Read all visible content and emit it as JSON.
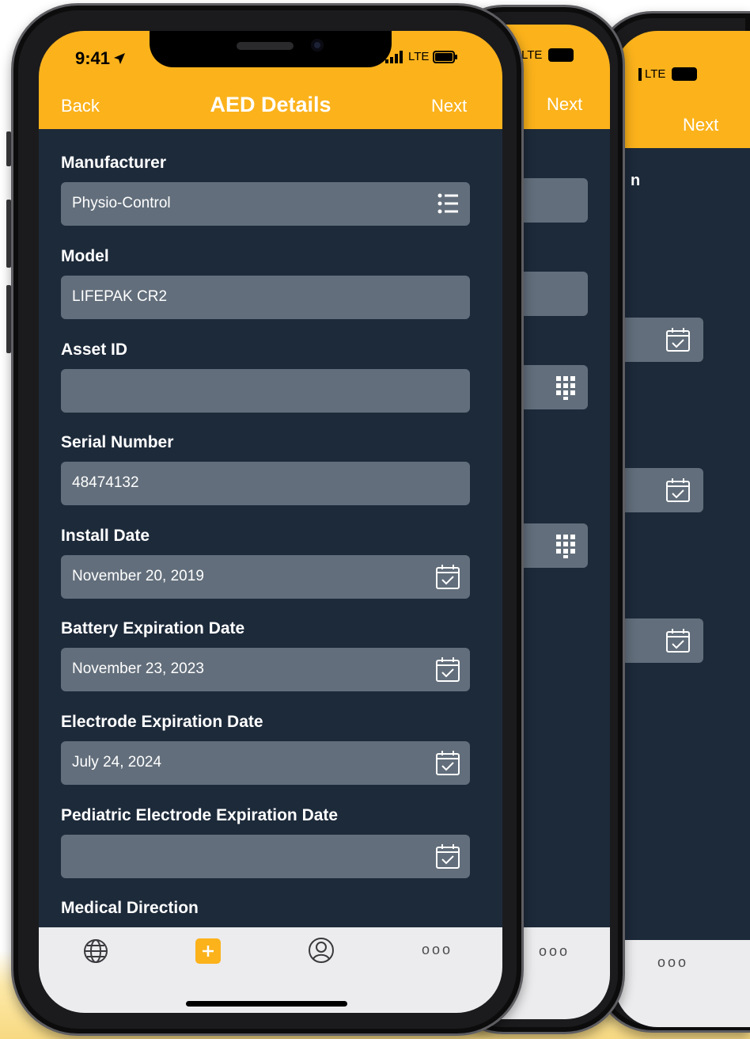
{
  "status_bar": {
    "time": "9:41",
    "network": "LTE"
  },
  "nav": {
    "back": "Back",
    "title": "AED Details",
    "next": "Next"
  },
  "fields": [
    {
      "label": "Manufacturer",
      "value": "Physio-Control",
      "icon": "list-icon"
    },
    {
      "label": "Model",
      "value": "LIFEPAK CR2",
      "icon": ""
    },
    {
      "label": "Asset ID",
      "value": "",
      "icon": ""
    },
    {
      "label": "Serial Number",
      "value": "48474132",
      "icon": ""
    },
    {
      "label": "Install Date",
      "value": "November 20, 2019",
      "icon": "calendar-icon"
    },
    {
      "label": "Battery Expiration Date",
      "value": "November 23, 2023",
      "icon": "calendar-icon"
    },
    {
      "label": "Electrode Expiration Date",
      "value": "July 24, 2024",
      "icon": "calendar-icon"
    },
    {
      "label": "Pediatric Electrode Expiration Date",
      "value": "",
      "icon": "calendar-icon"
    }
  ],
  "section_heading": "Medical Direction",
  "tabbar": {
    "tabs": [
      "globe-icon",
      "add-icon",
      "profile-icon",
      "more-icon"
    ],
    "more_label": "ooo"
  },
  "back_phone_2": {
    "next": "Next",
    "network": "LTE",
    "more_label": "ooo"
  },
  "back_phone_3": {
    "next": "Next",
    "network": "LTE",
    "label_fragment": "n",
    "more_label": "ooo"
  },
  "colors": {
    "accent": "#fbb21b",
    "background": "#1d2a3a",
    "field": "#626e7b",
    "tabbar": "#ececee"
  }
}
